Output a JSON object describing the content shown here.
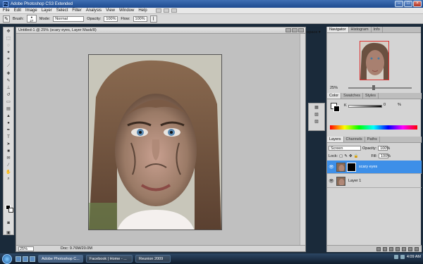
{
  "app": {
    "title": "Adobe Photoshop CS3 Extended",
    "logo_text": "Ps"
  },
  "menu": [
    "File",
    "Edit",
    "Image",
    "Layer",
    "Select",
    "Filter",
    "Analysis",
    "View",
    "Window",
    "Help"
  ],
  "options_bar": {
    "brush_label": "Brush:",
    "brush_size": "27",
    "mode_label": "Mode:",
    "mode_value": "Normal",
    "opacity_label": "Opacity:",
    "opacity_value": "100%",
    "flow_label": "Flow:",
    "flow_value": "100%",
    "workspace_label": "Workspace ▾"
  },
  "document": {
    "tab_title": "Untitled-1 @ 25% (scary eyes, Layer Mask/8)",
    "zoom": "25%",
    "doc_info": "Doc: 9.76M/20.0M"
  },
  "navigator": {
    "tabs": [
      "Navigator",
      "Histogram",
      "Info"
    ],
    "zoom": "25%"
  },
  "color_panel": {
    "tabs": [
      "Color",
      "Swatches",
      "Styles"
    ],
    "channel": "K",
    "value": "0",
    "unit": "%"
  },
  "layers_panel": {
    "tabs": [
      "Layers",
      "Channels",
      "Paths"
    ],
    "blend_mode": "Screen",
    "opacity_label": "Opacity:",
    "opacity_value": "100%",
    "lock_label": "Lock:",
    "fill_label": "Fill:",
    "fill_value": "100%",
    "layers": [
      {
        "name": "scary eyes",
        "selected": true
      },
      {
        "name": "Layer 1",
        "selected": false
      }
    ]
  },
  "taskbar": {
    "items": [
      "Adobe Photoshop C...",
      "Facebook | Home - ...",
      "Reunion 2009"
    ],
    "clock": "4:09 AM"
  }
}
